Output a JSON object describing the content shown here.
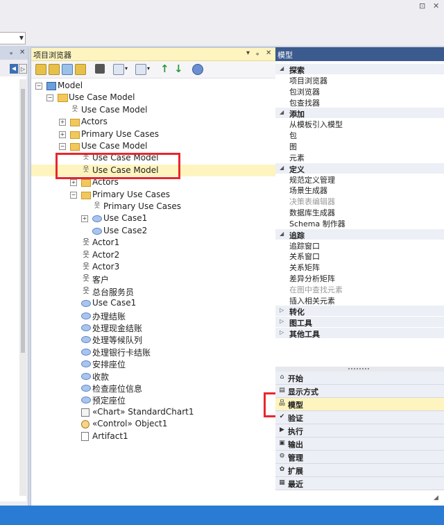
{
  "titlebar": {
    "restore_glyph": "⊡",
    "close_glyph": "✕"
  },
  "left_panel": {
    "pin_glyph": "ᵩ",
    "close_glyph": "✕",
    "prev_glyph": "◀",
    "next_glyph": "▷"
  },
  "project_browser": {
    "title": "项目浏览器",
    "controls": {
      "dropdown": "▾",
      "pin": "ᵩ",
      "close": "✕"
    },
    "toolbar_icons": [
      "new-package-icon",
      "new-view-icon",
      "new-model-icon",
      "new-element-icon",
      "find-icon",
      "edit-icon",
      "dropdown-icon",
      "show-icon",
      "dropdown-icon",
      "move-up-icon",
      "move-down-icon",
      "help-icon"
    ],
    "tree": [
      {
        "label": "Model",
        "icon": "model-root-icon",
        "expander": "−"
      },
      {
        "label": "Use Case Model",
        "icon": "package-model-icon",
        "expander": "−"
      },
      {
        "label": "Use Case Model",
        "icon": "use-case-diagram-icon",
        "expander": ""
      },
      {
        "label": "Actors",
        "icon": "folder-icon",
        "expander": "+"
      },
      {
        "label": "Primary Use Cases",
        "icon": "folder-icon",
        "expander": "+"
      },
      {
        "label": "Use Case Model",
        "icon": "folder-icon",
        "expander": "−"
      },
      {
        "label": "Use Case Model",
        "icon": "use-case-diagram-icon",
        "expander": ""
      },
      {
        "label": "Use Case Model",
        "icon": "use-case-diagram-icon",
        "expander": ""
      },
      {
        "label": "Actors",
        "icon": "folder-icon",
        "expander": "+"
      },
      {
        "label": "Primary Use Cases",
        "icon": "folder-icon",
        "expander": "−"
      },
      {
        "label": "Primary Use Cases",
        "icon": "use-case-diagram-icon",
        "expander": ""
      },
      {
        "label": "Use Case1",
        "icon": "use-case-icon",
        "expander": "+"
      },
      {
        "label": "Use Case2",
        "icon": "use-case-icon",
        "expander": ""
      },
      {
        "label": "Actor1",
        "icon": "actor-icon",
        "expander": ""
      },
      {
        "label": "Actor2",
        "icon": "actor-icon",
        "expander": ""
      },
      {
        "label": "Actor3",
        "icon": "actor-icon",
        "expander": ""
      },
      {
        "label": "客户",
        "icon": "actor-icon",
        "expander": ""
      },
      {
        "label": "总台服务员",
        "icon": "actor-icon",
        "expander": ""
      },
      {
        "label": "Use Case1",
        "icon": "use-case-icon",
        "expander": ""
      },
      {
        "label": "办理结账",
        "icon": "use-case-icon",
        "expander": ""
      },
      {
        "label": "处理现金结账",
        "icon": "use-case-icon",
        "expander": ""
      },
      {
        "label": "处理等候队列",
        "icon": "use-case-icon",
        "expander": ""
      },
      {
        "label": "处理银行卡结账",
        "icon": "use-case-icon",
        "expander": ""
      },
      {
        "label": "安排座位",
        "icon": "use-case-icon",
        "expander": ""
      },
      {
        "label": "收款",
        "icon": "use-case-icon",
        "expander": ""
      },
      {
        "label": "检查座位信息",
        "icon": "use-case-icon",
        "expander": ""
      },
      {
        "label": "预定座位",
        "icon": "use-case-icon",
        "expander": ""
      },
      {
        "label": "«Chart» StandardChart1",
        "icon": "chart-icon",
        "expander": ""
      },
      {
        "label": "«Control» Object1",
        "icon": "object-icon",
        "expander": ""
      },
      {
        "label": "Artifact1",
        "icon": "artifact-icon",
        "expander": ""
      }
    ]
  },
  "model_panel": {
    "title": "模型",
    "sections": [
      {
        "name": "探索",
        "expanded": true,
        "items": [
          {
            "label": "项目浏览器"
          },
          {
            "label": "包浏览器"
          },
          {
            "label": "包查找器"
          }
        ]
      },
      {
        "name": "添加",
        "expanded": true,
        "items": [
          {
            "label": "从模板引入模型"
          },
          {
            "label": "包"
          },
          {
            "label": "图"
          },
          {
            "label": "元素"
          }
        ]
      },
      {
        "name": "定义",
        "expanded": true,
        "items": [
          {
            "label": "规范定义管理"
          },
          {
            "label": "场景生成器"
          },
          {
            "label": "决策表编辑器",
            "disabled": true
          },
          {
            "label": "数据库生成器"
          },
          {
            "label": "Schema 制作器"
          }
        ]
      },
      {
        "name": "追踪",
        "expanded": true,
        "items": [
          {
            "label": "追踪窗口"
          },
          {
            "label": "关系窗口"
          },
          {
            "label": "关系矩阵"
          },
          {
            "label": "差异分析矩阵"
          },
          {
            "label": "在图中查找元素",
            "disabled": true
          },
          {
            "label": "插入相关元素"
          }
        ]
      },
      {
        "name": "转化",
        "expanded": false,
        "items": []
      },
      {
        "name": "图工具",
        "expanded": false,
        "items": []
      },
      {
        "name": "其他工具",
        "expanded": false,
        "items": []
      }
    ],
    "expanded_arrow": "◢",
    "collapsed_arrow": "▷",
    "nav": [
      {
        "label": "开始",
        "icon": "start-icon",
        "glyph": "⌂"
      },
      {
        "label": "显示方式",
        "icon": "display-icon",
        "glyph": "▤"
      },
      {
        "label": "模型",
        "icon": "model-icon",
        "glyph": "品",
        "selected": true
      },
      {
        "label": "验证",
        "icon": "validate-icon",
        "glyph": "✔"
      },
      {
        "label": "执行",
        "icon": "execute-icon",
        "glyph": "▶"
      },
      {
        "label": "输出",
        "icon": "output-icon",
        "glyph": "▣"
      },
      {
        "label": "管理",
        "icon": "manage-icon",
        "glyph": "⚙"
      },
      {
        "label": "扩展",
        "icon": "extend-icon",
        "glyph": "✿"
      },
      {
        "label": "最近",
        "icon": "recent-icon",
        "glyph": "▦"
      }
    ],
    "footer_glyph": "◢"
  },
  "colors": {
    "accent": "#2a7bd4",
    "highlight": "#fdf4bf",
    "annotation_red": "#e8262d",
    "panel_title": "#3b5a8e"
  }
}
